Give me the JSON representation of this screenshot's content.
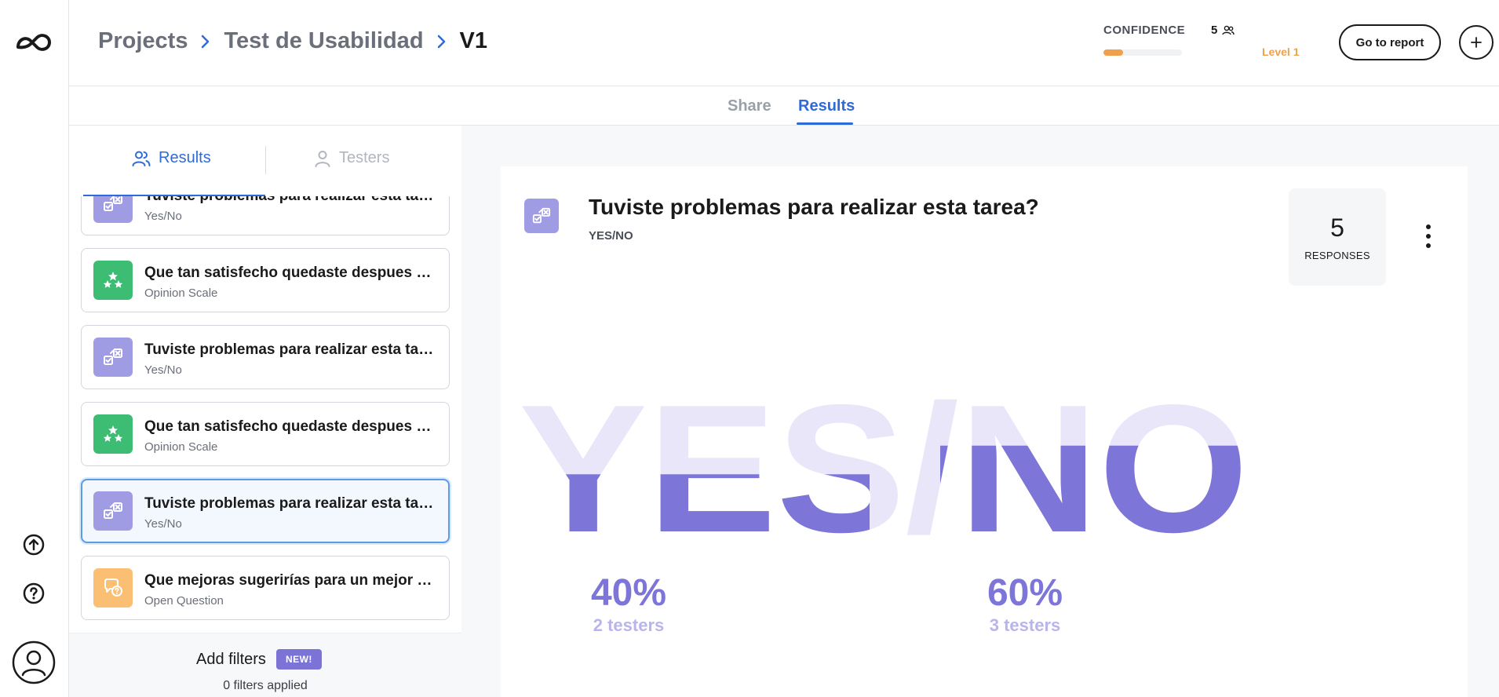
{
  "breadcrumb": {
    "items": [
      "Projects",
      "Test de Usabilidad",
      "V1"
    ]
  },
  "confidence": {
    "label": "CONFIDENCE",
    "count": "5",
    "level": "Level 1",
    "progress_fraction": 0.25,
    "color": "#f0a04b"
  },
  "header": {
    "go_to_report": "Go to report"
  },
  "tabs": {
    "share": "Share",
    "results": "Results"
  },
  "sidebar": {
    "tab_results": "Results",
    "tab_testers": "Testers",
    "questions": [
      {
        "title": "Tuviste problemas para realizar esta tarea?",
        "type": "Yes/No",
        "icon": "yes-no-icon",
        "color": "purple"
      },
      {
        "title": "Que tan satisfecho quedaste despues de realizar la tarea?",
        "type": "Opinion Scale",
        "icon": "stars-icon",
        "color": "green"
      },
      {
        "title": "Tuviste problemas para realizar esta tarea?",
        "type": "Yes/No",
        "icon": "yes-no-icon",
        "color": "purple"
      },
      {
        "title": "Que tan satisfecho quedaste despues de realizar la tarea?",
        "type": "Opinion Scale",
        "icon": "stars-icon",
        "color": "green"
      },
      {
        "title": "Tuviste problemas para realizar esta tarea?",
        "type": "Yes/No",
        "icon": "yes-no-icon",
        "color": "purple",
        "selected": true
      },
      {
        "title": "Que mejoras sugerirías para un mejor uso?",
        "type": "Open Question",
        "icon": "speech-bubble-icon",
        "color": "orange"
      }
    ],
    "filters_title": "Add filters",
    "filters_badge": "NEW!",
    "filters_applied": "0 filters applied"
  },
  "panel": {
    "title": "Tuviste problemas para realizar esta tarea?",
    "type": "YES/NO",
    "responses_count": "5",
    "responses_label": "RESPONSES",
    "big_text": "YES/NO"
  },
  "results": {
    "yes_percent": "40%",
    "yes_testers": "2 testers",
    "no_percent": "60%",
    "no_testers": "3 testers",
    "yes_fraction": 0.4,
    "no_fraction": 0.6
  },
  "colors": {
    "accent_blue": "#2f6bd8",
    "purple_dark": "#7d76d8",
    "purple_light": "#e8e6f8"
  }
}
